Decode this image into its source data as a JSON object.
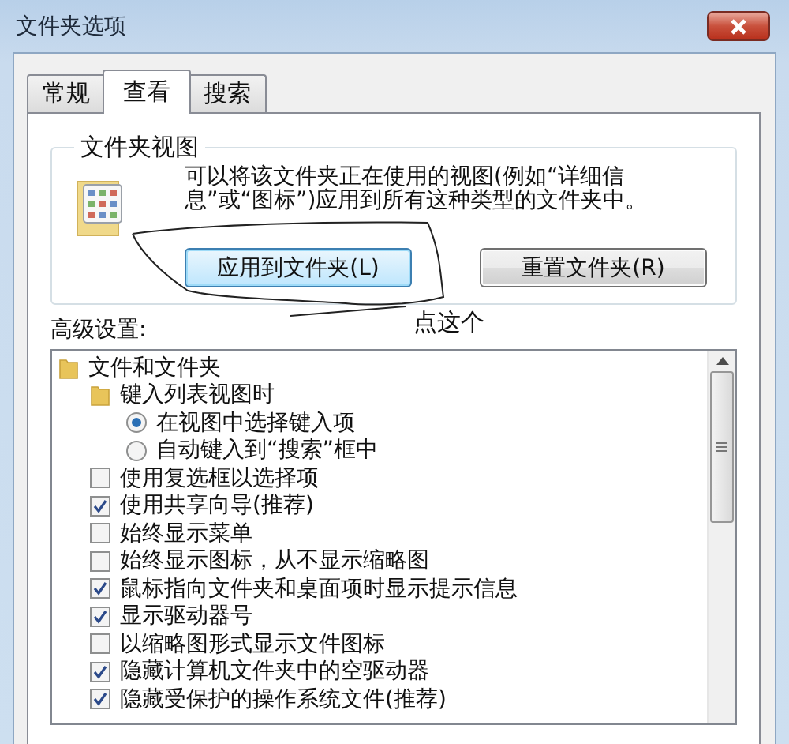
{
  "window": {
    "title": "文件夹选项"
  },
  "tabs": [
    {
      "label": "常规",
      "selected": false
    },
    {
      "label": "查看",
      "selected": true
    },
    {
      "label": "搜索",
      "selected": false
    }
  ],
  "folder_views": {
    "title": "文件夹视图",
    "description": "可以将该文件夹正在使用的视图(例如“详细信息”或“图标”)应用到所有这种类型的文件夹中。",
    "buttons": [
      {
        "label": "应用到文件夹(L)",
        "focused": true
      },
      {
        "label": "重置文件夹(R)",
        "focused": false
      }
    ]
  },
  "annotation": {
    "text": "点这个"
  },
  "advanced": {
    "label": "高级设置:",
    "items": [
      {
        "kind": "folder",
        "label": "文件和文件夹",
        "children": [
          {
            "kind": "folder",
            "label": "键入列表视图时",
            "children": [
              {
                "kind": "radio",
                "label": "在视图中选择键入项",
                "selected": true
              },
              {
                "kind": "radio",
                "label": "自动键入到“搜索”框中",
                "selected": false
              }
            ]
          },
          {
            "kind": "checkbox",
            "label": "使用复选框以选择项",
            "checked": false
          },
          {
            "kind": "checkbox",
            "label": "使用共享向导(推荐)",
            "checked": true
          },
          {
            "kind": "checkbox",
            "label": "始终显示菜单",
            "checked": false
          },
          {
            "kind": "checkbox",
            "label": "始终显示图标，从不显示缩略图",
            "checked": false
          },
          {
            "kind": "checkbox",
            "label": "鼠标指向文件夹和桌面项时显示提示信息",
            "checked": true
          },
          {
            "kind": "checkbox",
            "label": "显示驱动器号",
            "checked": true
          },
          {
            "kind": "checkbox",
            "label": "以缩略图形式显示文件图标",
            "checked": false
          },
          {
            "kind": "checkbox",
            "label": "隐藏计算机文件夹中的空驱动器",
            "checked": true
          },
          {
            "kind": "checkbox",
            "label": "隐藏受保护的操作系统文件(推荐)",
            "checked": true
          }
        ]
      }
    ]
  }
}
